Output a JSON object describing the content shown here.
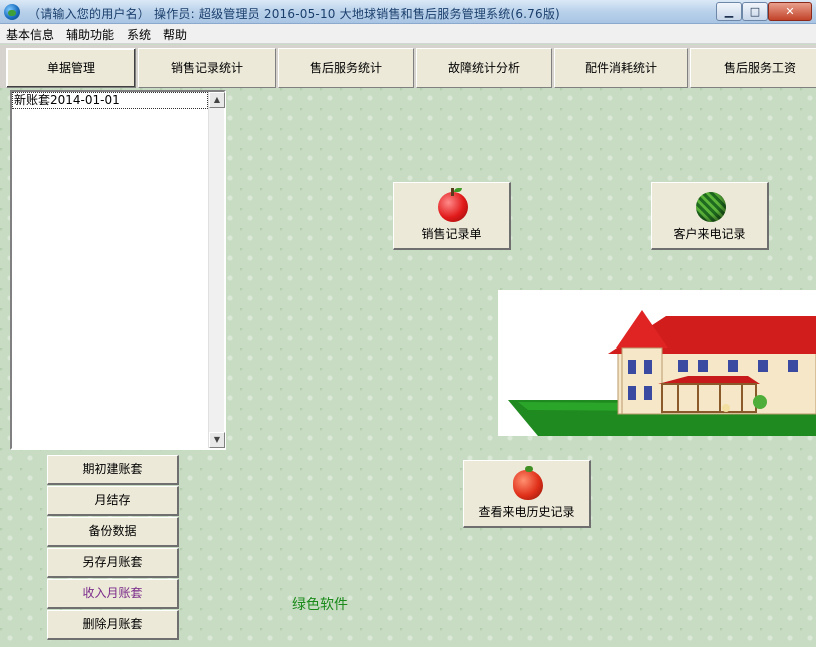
{
  "window": {
    "title": "（请输入您的用户名）   操作员: 超级管理员   2016-05-10   大地球销售和售后服务管理系统(6.76版)",
    "min_label": "▁",
    "max_label": "□",
    "close_label": "✕"
  },
  "menu": {
    "items": [
      "基本信息",
      "辅助功能",
      "系统",
      "帮助"
    ]
  },
  "tabs": [
    "单据管理",
    "销售记录统计",
    "售后服务统计",
    "故障统计分析",
    "配件消耗统计",
    "售后服务工资"
  ],
  "list": {
    "rows": [
      "新账套2014-01-01"
    ],
    "scroll_up": "▲",
    "scroll_down": "▼"
  },
  "commands": [
    "期初建账套",
    "月结存",
    "备份数据",
    "另存月账套",
    "收入月账套",
    "删除月账套"
  ],
  "big_buttons": {
    "sales_record": "销售记录单",
    "customer_call": "客户来电记录",
    "call_history": "查看来电历史记录"
  },
  "footer": {
    "green_text": "绿色软件"
  },
  "colors": {
    "title_text": "#1b3f6c",
    "green_text": "#1a8a1a",
    "accent_purple": "#7a2a8a"
  }
}
